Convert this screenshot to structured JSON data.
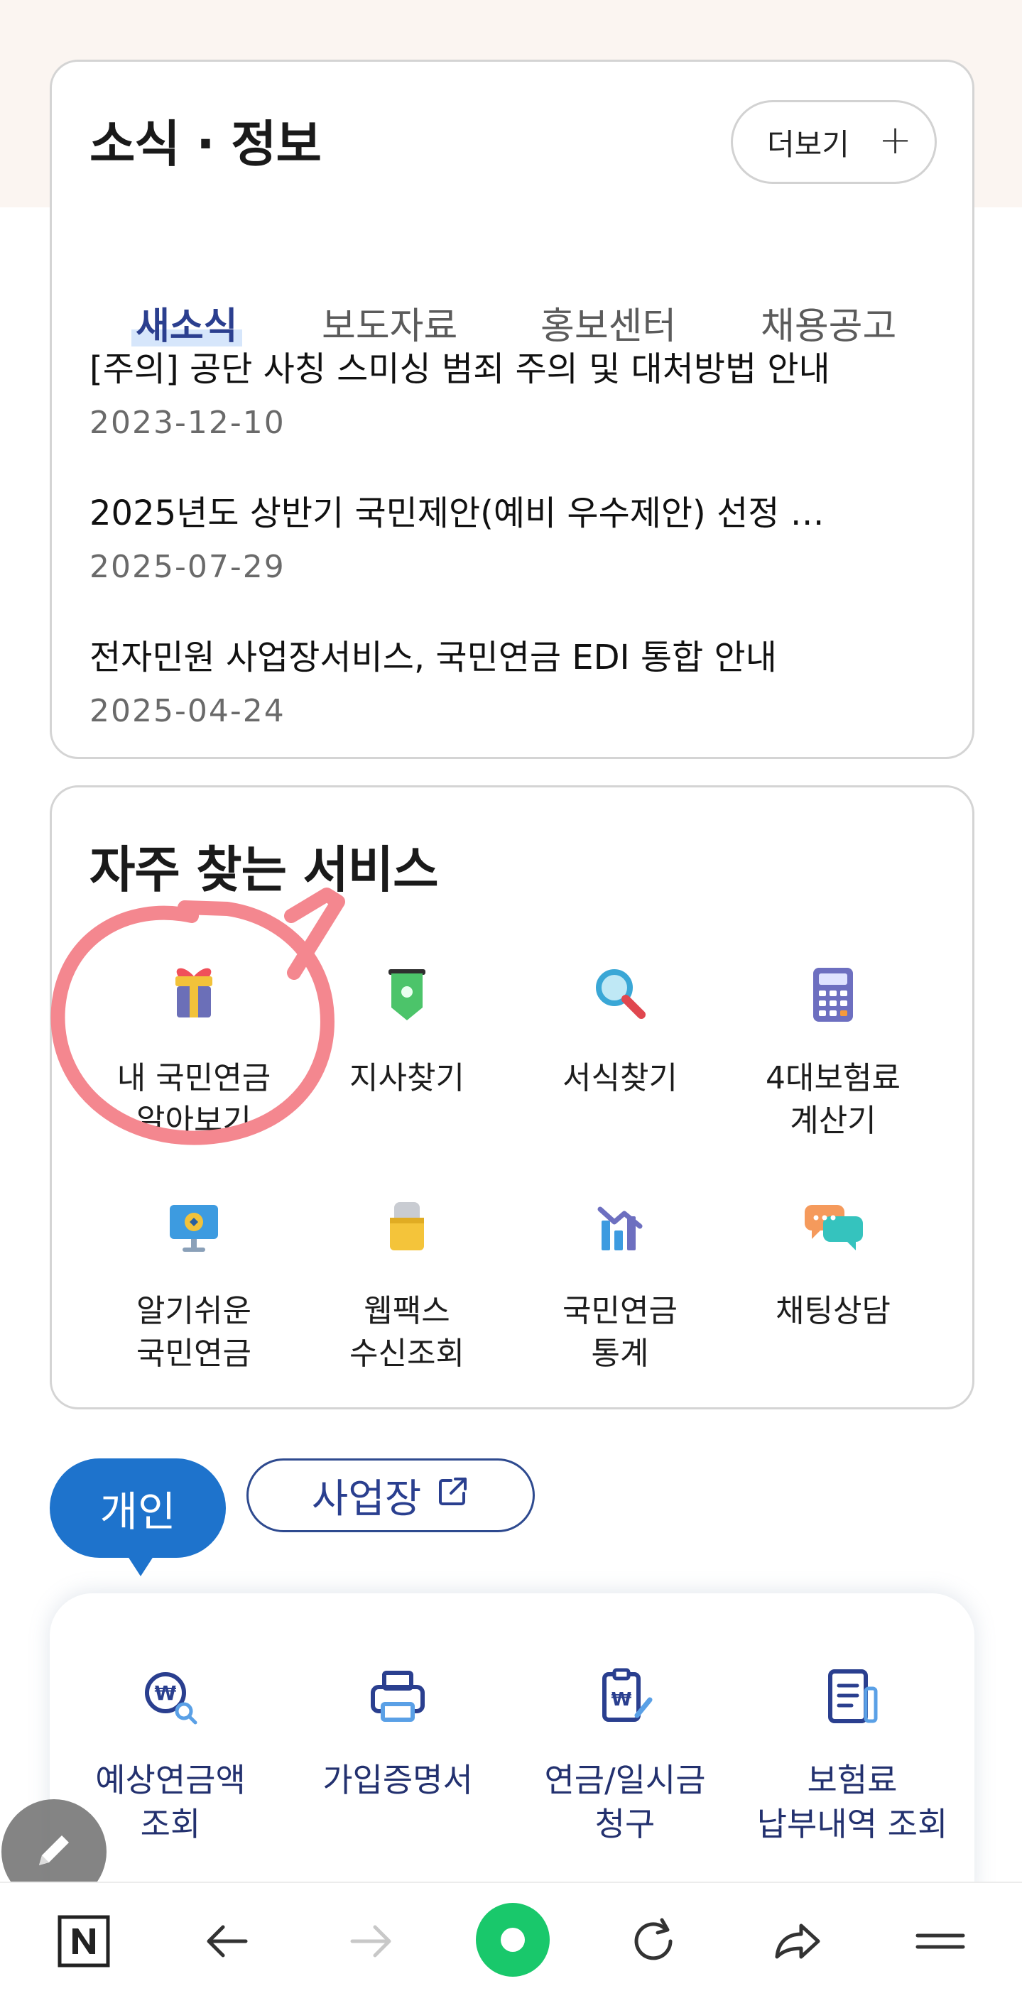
{
  "news": {
    "title": "소식 · 정보",
    "more_label": "더보기",
    "more_plus": "+",
    "tabs": [
      {
        "label": "새소식",
        "active": true
      },
      {
        "label": "보도자료",
        "active": false
      },
      {
        "label": "홍보센터",
        "active": false
      },
      {
        "label": "채용공고",
        "active": false
      }
    ],
    "items": [
      {
        "title": "[주의] 공단 사칭 스미싱 범죄 주의 및 대처방법 안내",
        "date": "2023-12-10"
      },
      {
        "title": "2025년도 상반기 국민제안(예비 우수제안) 선정 …",
        "date": "2025-07-29"
      },
      {
        "title": "전자민원 사업장서비스, 국민연금 EDI 통합 안내",
        "date": "2025-04-24"
      }
    ]
  },
  "services": {
    "title": "자주 찾는 서비스",
    "items": [
      {
        "line1": "내 국민연금",
        "line2": "알아보기",
        "icon": "gift-icon"
      },
      {
        "line1": "지사찾기",
        "line2": "",
        "icon": "location-pin-icon"
      },
      {
        "line1": "서식찾기",
        "line2": "",
        "icon": "magnifier-icon"
      },
      {
        "line1": "4대보험료",
        "line2": "계산기",
        "icon": "calculator-icon"
      },
      {
        "line1": "알기쉬운",
        "line2": "국민연금",
        "icon": "monitor-icon"
      },
      {
        "line1": "웹팩스",
        "line2": "수신조회",
        "icon": "lock-icon"
      },
      {
        "line1": "국민연금",
        "line2": "통계",
        "icon": "bar-chart-icon"
      },
      {
        "line1": "채팅상담",
        "line2": "",
        "icon": "chat-bubbles-icon"
      }
    ]
  },
  "segments": {
    "personal": "개인",
    "business": "사업장"
  },
  "quick": [
    {
      "line1": "예상연금액",
      "line2": "조회",
      "icon": "pension-search-icon"
    },
    {
      "line1": "가입증명서",
      "line2": "",
      "icon": "printer-icon"
    },
    {
      "line1": "연금/일시금",
      "line2": "청구",
      "icon": "clipboard-pen-icon"
    },
    {
      "line1": "보험료",
      "line2": "납부내역 조회",
      "icon": "document-icon"
    }
  ],
  "colors": {
    "brand_blue": "#1e73cc",
    "navy": "#2a3f8f",
    "annotation_pink": "#f4878f",
    "nav_green": "#19c86b"
  }
}
